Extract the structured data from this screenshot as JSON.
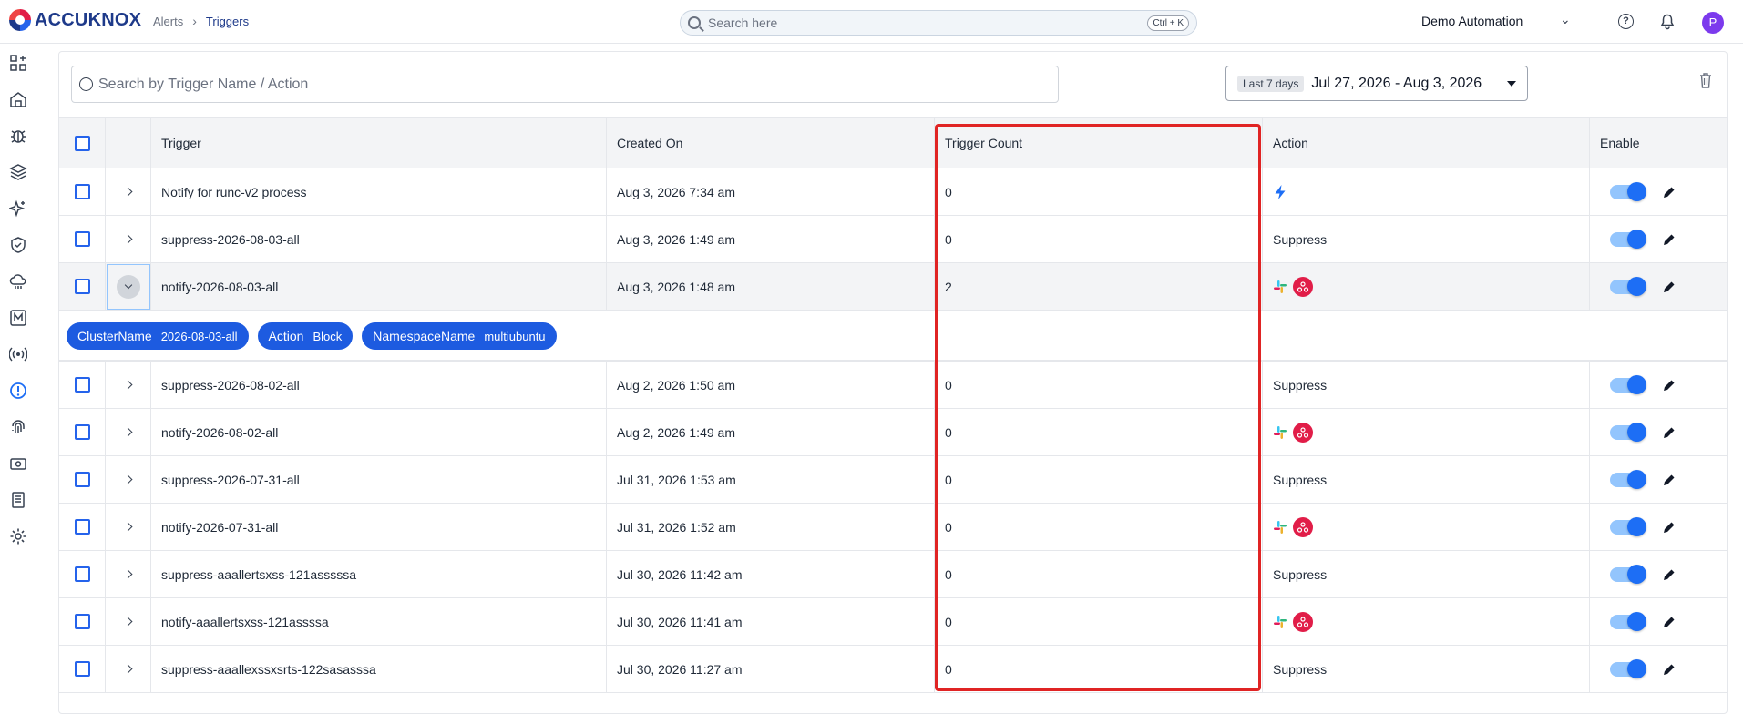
{
  "header": {
    "logo_text": "ACCUKNOX",
    "breadcrumb": [
      "Alerts",
      "Triggers"
    ],
    "search_placeholder": "Search here",
    "search_shortcut": "Ctrl + K",
    "org_name": "Demo Automation",
    "avatar_initial": "P"
  },
  "sidebar": {
    "icons": [
      "dashboard-add-icon",
      "home-icon",
      "bug-icon",
      "layers-icon",
      "sparkle-icon",
      "shield-check-icon",
      "cloud-icon",
      "m-box-icon",
      "broadcast-icon",
      "alert-badge-icon",
      "fingerprint-icon",
      "ticket-icon",
      "report-icon",
      "gear-icon"
    ]
  },
  "toolbar": {
    "search_placeholder": "Search by Trigger Name / Action",
    "date_chip": "Last 7 days",
    "date_range": "Jul 27, 2026 - Aug 3, 2026"
  },
  "table": {
    "columns": [
      "Trigger",
      "Created On",
      "Trigger Count",
      "Action",
      "Enable"
    ],
    "rows": [
      {
        "trigger": "Notify for runc-v2 process",
        "created": "Aug 3, 2026 7:34 am",
        "count": "0",
        "action": "",
        "action_icon": "lightning-icon"
      },
      {
        "trigger": "suppress-2026-08-03-all",
        "created": "Aug 3, 2026 1:49 am",
        "count": "0",
        "action": "Suppress",
        "action_icon": ""
      },
      {
        "trigger": "notify-2026-08-03-all",
        "created": "Aug 3, 2026 1:48 am",
        "count": "2",
        "action": "",
        "action_icon": "slack-webhook"
      },
      {
        "trigger": "suppress-2026-08-02-all",
        "created": "Aug 2, 2026 1:50 am",
        "count": "0",
        "action": "Suppress",
        "action_icon": ""
      },
      {
        "trigger": "notify-2026-08-02-all",
        "created": "Aug 2, 2026 1:49 am",
        "count": "0",
        "action": "",
        "action_icon": "slack-webhook"
      },
      {
        "trigger": "suppress-2026-07-31-all",
        "created": "Jul 31, 2026 1:53 am",
        "count": "0",
        "action": "Suppress",
        "action_icon": ""
      },
      {
        "trigger": "notify-2026-07-31-all",
        "created": "Jul 31, 2026 1:52 am",
        "count": "0",
        "action": "",
        "action_icon": "slack-webhook"
      },
      {
        "trigger": "suppress-aaallertsxss-121asssssa",
        "created": "Jul 30, 2026 11:42 am",
        "count": "0",
        "action": "Suppress",
        "action_icon": ""
      },
      {
        "trigger": "notify-aaallertsxss-121assssa",
        "created": "Jul 30, 2026 11:41 am",
        "count": "0",
        "action": "",
        "action_icon": "slack-webhook"
      },
      {
        "trigger": "suppress-aaallexssxsrts-122sasasssa",
        "created": "Jul 30, 2026 11:27 am",
        "count": "0",
        "action": "Suppress",
        "action_icon": ""
      }
    ],
    "expanded_chips": [
      {
        "key": "ClusterName",
        "value": "2026-08-03-all"
      },
      {
        "key": "Action",
        "value": "Block"
      },
      {
        "key": "NamespaceName",
        "value": "multiubuntu"
      }
    ]
  },
  "colors": {
    "accent": "#1d6ef5",
    "chip": "#1d5be0",
    "highlight": "#e02424",
    "webhook": "#e11d48"
  }
}
